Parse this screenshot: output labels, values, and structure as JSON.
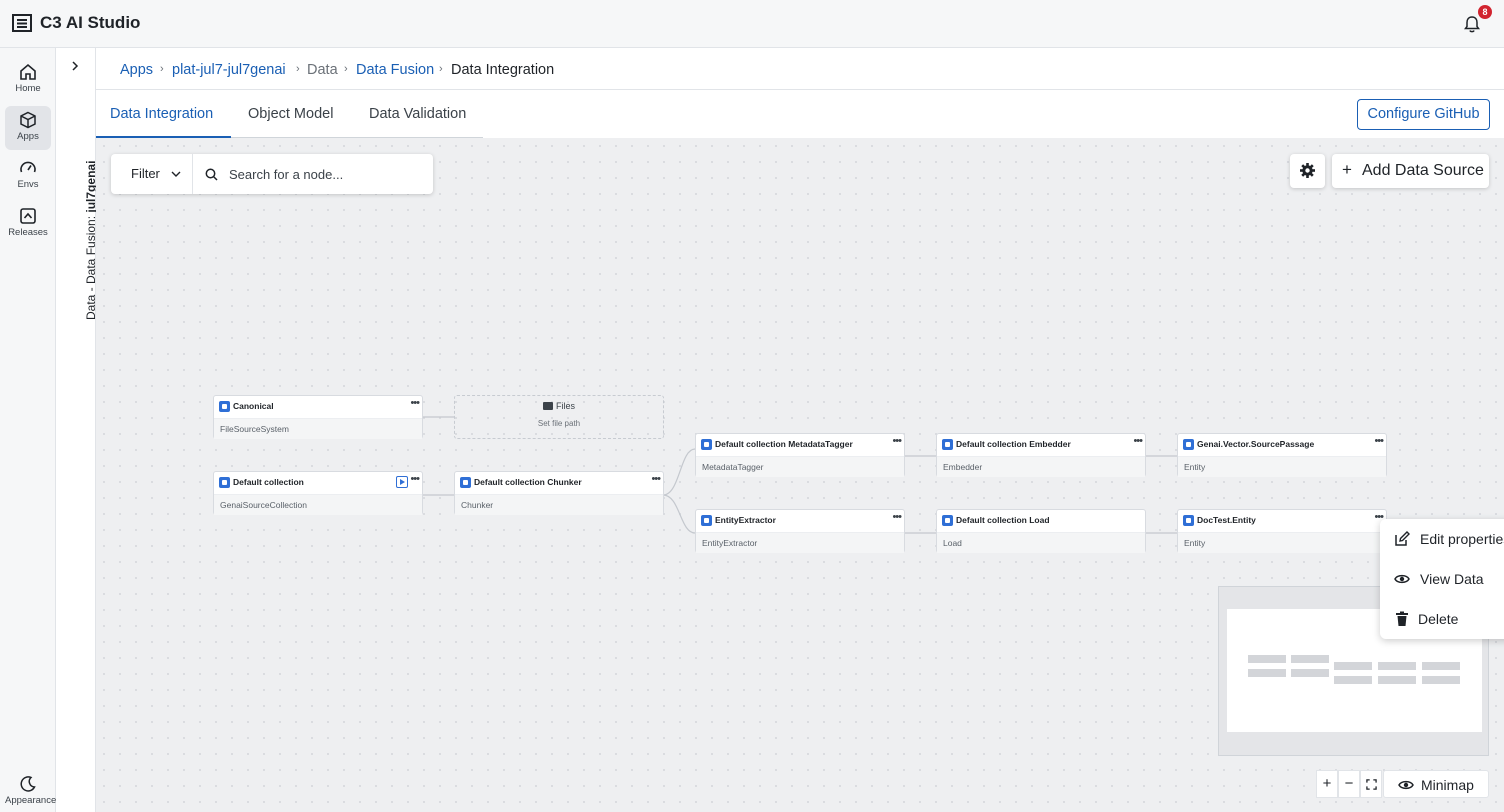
{
  "app": {
    "title": "C3 AI Studio",
    "notification_count": "8"
  },
  "rail": {
    "items": [
      {
        "label": "Home",
        "icon": "home-icon"
      },
      {
        "label": "Apps",
        "icon": "cube-icon"
      },
      {
        "label": "Envs",
        "icon": "gauge-icon"
      },
      {
        "label": "Releases",
        "icon": "release-icon"
      }
    ],
    "appearance": "Appearance"
  },
  "subrail": {
    "prefix": "Data - Data Fusion: ",
    "app": "jul7genai"
  },
  "breadcrumb": [
    "Apps",
    "plat-jul7-jul7genai",
    "Data",
    "Data Fusion",
    "Data Integration"
  ],
  "tabs": [
    "Data Integration",
    "Object Model",
    "Data Validation"
  ],
  "configure_github": "Configure GitHub",
  "canvas": {
    "filter_label": "Filter",
    "search_placeholder": "Search for a node...",
    "add_data_source": "Add Data Source",
    "minimap_label": "Minimap"
  },
  "nodes": {
    "canonical": {
      "title": "Canonical",
      "sub": "FileSourceSystem"
    },
    "files": {
      "title": "Files",
      "sub": "Set file path"
    },
    "default_collection": {
      "title": "Default collection",
      "sub": "GenaiSourceCollection"
    },
    "chunker": {
      "title": "Default collection Chunker",
      "sub": "Chunker"
    },
    "metadata_tagger": {
      "title": "Default collection MetadataTagger",
      "sub": "MetadataTagger"
    },
    "embedder": {
      "title": "Default collection Embedder",
      "sub": "Embedder"
    },
    "source_passage": {
      "title": "Genai.Vector.SourcePassage",
      "sub": "Entity"
    },
    "entity_extractor": {
      "title": "EntityExtractor",
      "sub": "EntityExtractor"
    },
    "load": {
      "title": "Default collection Load",
      "sub": "Load"
    },
    "doctest_entity": {
      "title": "DocTest.Entity",
      "sub": "Entity"
    }
  },
  "context_menu": [
    "Edit properties",
    "View Data",
    "Delete"
  ],
  "colors": {
    "accent": "#1a5fb4",
    "node_icon": "#2f6fd6",
    "badge": "#d1242f"
  }
}
